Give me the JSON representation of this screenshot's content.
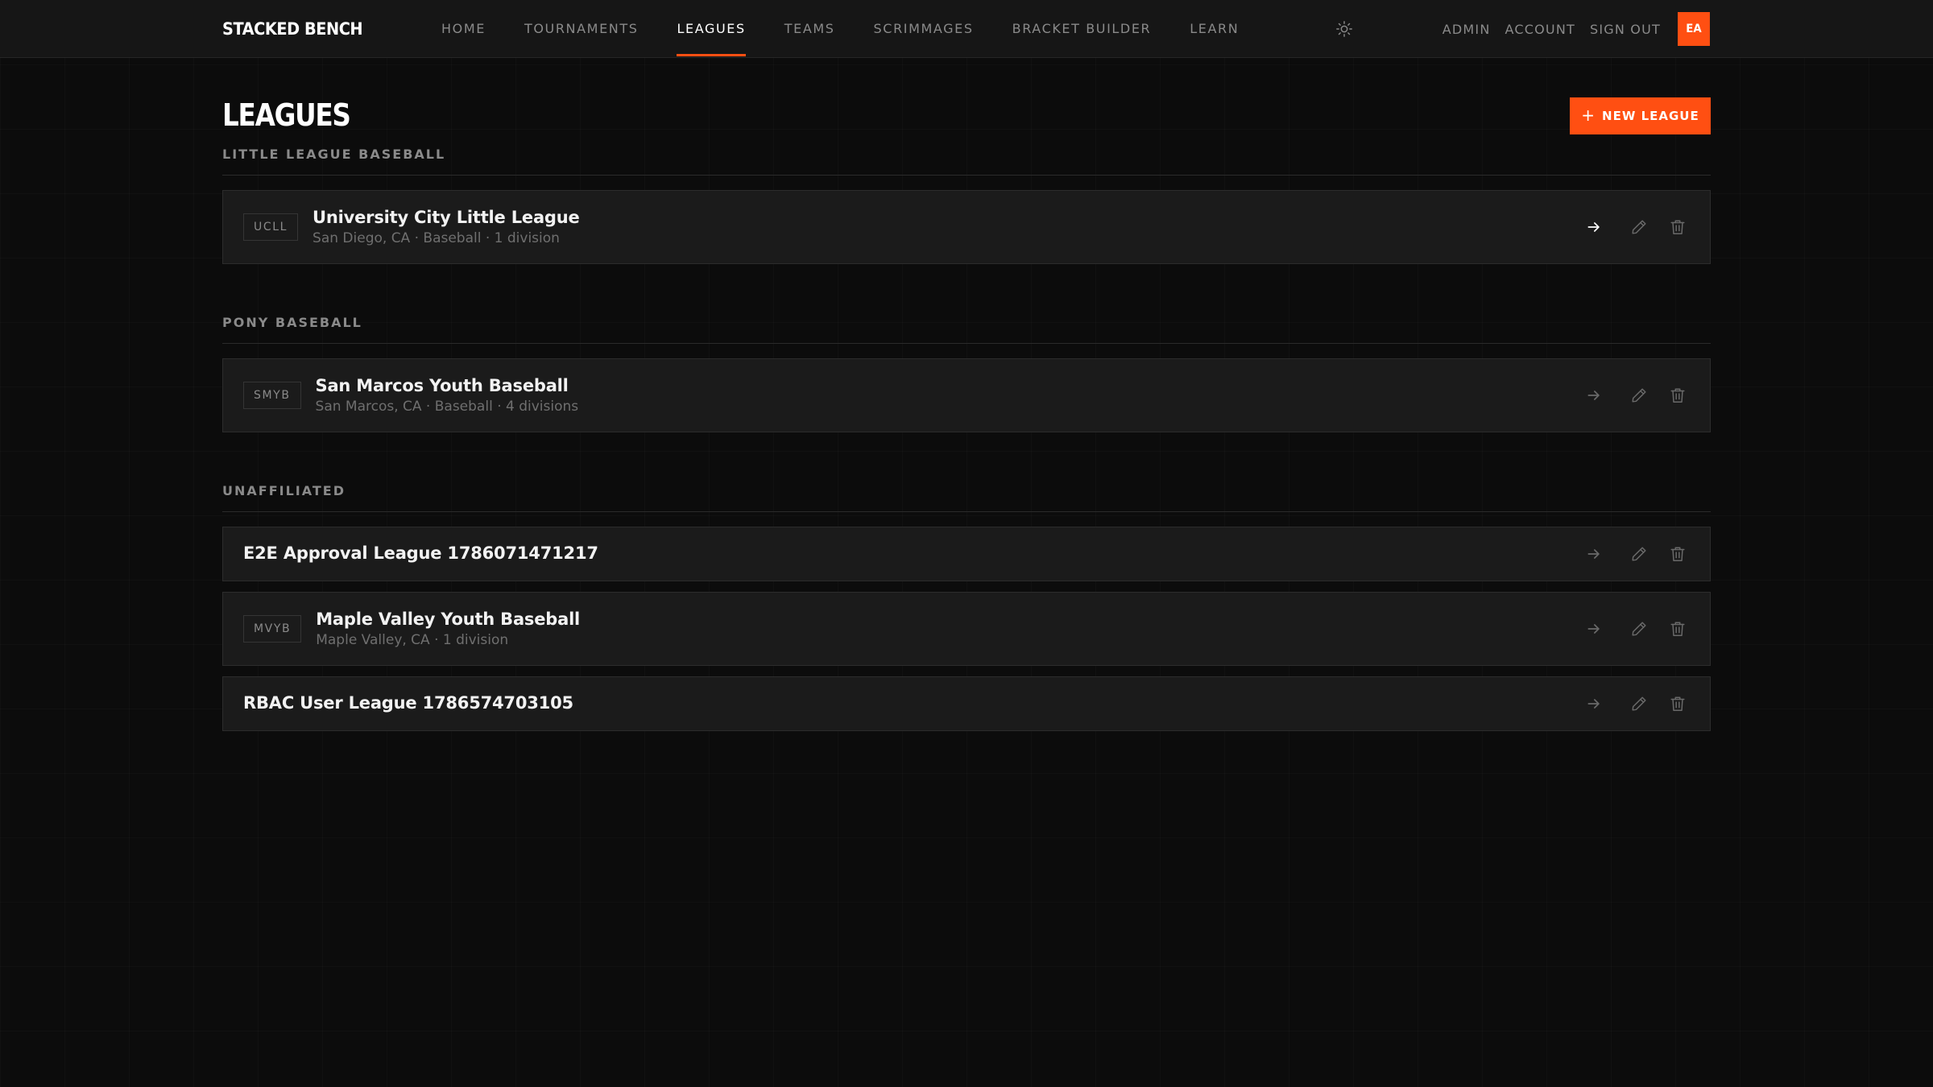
{
  "brand": "STACKED BENCH",
  "nav": {
    "items": [
      {
        "label": "HOME",
        "active": false
      },
      {
        "label": "TOURNAMENTS",
        "active": false
      },
      {
        "label": "LEAGUES",
        "active": true
      },
      {
        "label": "TEAMS",
        "active": false
      },
      {
        "label": "SCRIMMAGES",
        "active": false
      },
      {
        "label": "BRACKET BUILDER",
        "active": false
      },
      {
        "label": "LEARN",
        "active": false
      }
    ],
    "theme_icon": "sun-icon",
    "right_links": [
      "ADMIN",
      "ACCOUNT",
      "SIGN OUT"
    ],
    "avatar_initials": "EA"
  },
  "page": {
    "title": "LEAGUES",
    "new_button_label": "NEW LEAGUE"
  },
  "sections": [
    {
      "title": "LITTLE LEAGUE BASEBALL",
      "leagues": [
        {
          "abbr": "UCLL",
          "name": "University City Little League",
          "meta": "San Diego, CA · Baseball · 1 division",
          "arrow_active": true
        }
      ]
    },
    {
      "title": "PONY BASEBALL",
      "leagues": [
        {
          "abbr": "SMYB",
          "name": "San Marcos Youth Baseball",
          "meta": "San Marcos, CA · Baseball · 4 divisions",
          "arrow_active": false
        }
      ]
    },
    {
      "title": "UNAFFILIATED",
      "leagues": [
        {
          "abbr": "",
          "name": "E2E Approval League 1786071471217",
          "meta": "",
          "arrow_active": false
        },
        {
          "abbr": "MVYB",
          "name": "Maple Valley Youth Baseball",
          "meta": "Maple Valley, CA · 1 division",
          "arrow_active": false
        },
        {
          "abbr": "",
          "name": "RBAC User League 1786574703105",
          "meta": "",
          "arrow_active": false
        }
      ]
    }
  ],
  "colors": {
    "accent": "#ff4f12",
    "background": "#0c0c0c",
    "card": "#1b1b1b",
    "muted_text": "#8a8a8a"
  },
  "icons": {
    "row_actions": [
      "arrow-right-icon",
      "pencil-icon",
      "trash-icon"
    ]
  }
}
